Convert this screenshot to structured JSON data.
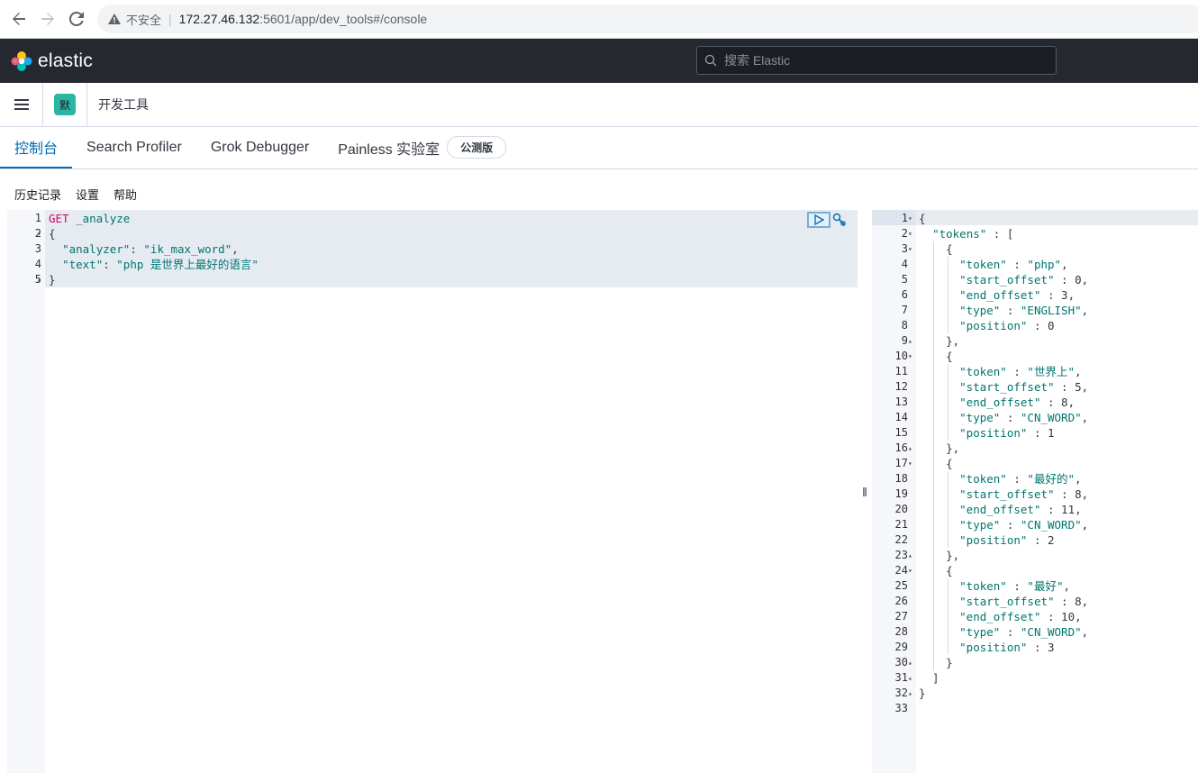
{
  "browser": {
    "security_label": "不安全",
    "url_host": "172.27.46.132",
    "url_path": ":5601/app/dev_tools#/console"
  },
  "header": {
    "logo_text": "elastic",
    "search_placeholder": "搜索 Elastic"
  },
  "subheader": {
    "space_initial": "默",
    "breadcrumb": "开发工具"
  },
  "tabs": [
    {
      "label": "控制台",
      "active": true
    },
    {
      "label": "Search Profiler",
      "active": false
    },
    {
      "label": "Grok Debugger",
      "active": false
    },
    {
      "label": "Painless 实验室",
      "active": false
    }
  ],
  "beta_badge": "公测版",
  "console_menu": [
    "历史记录",
    "设置",
    "帮助"
  ],
  "request": {
    "method": "GET",
    "endpoint": "_analyze",
    "lines": [
      {
        "no": "1",
        "fold": "",
        "segments": []
      },
      {
        "no": "2",
        "fold": "▾",
        "text": "{"
      },
      {
        "no": "3",
        "fold": "",
        "key": "\"analyzer\"",
        "value": "\"ik_max_word\"",
        "suffix": ","
      },
      {
        "no": "4",
        "fold": "",
        "key": "\"text\"",
        "value": "\"php 是世界上最好的语言\"",
        "suffix": ""
      },
      {
        "no": "5",
        "fold": "▴",
        "text": "}"
      }
    ]
  },
  "response": {
    "lines": [
      {
        "no": "1",
        "fold": "▾",
        "text": "{"
      },
      {
        "no": "2",
        "fold": "▾",
        "text": "  \"tokens\" : ["
      },
      {
        "no": "3",
        "fold": "▾",
        "text": "    {"
      },
      {
        "no": "4",
        "fold": "",
        "text": "      \"token\" : \"php\","
      },
      {
        "no": "5",
        "fold": "",
        "text": "      \"start_offset\" : 0,"
      },
      {
        "no": "6",
        "fold": "",
        "text": "      \"end_offset\" : 3,"
      },
      {
        "no": "7",
        "fold": "",
        "text": "      \"type\" : \"ENGLISH\","
      },
      {
        "no": "8",
        "fold": "",
        "text": "      \"position\" : 0"
      },
      {
        "no": "9",
        "fold": "▴",
        "text": "    },"
      },
      {
        "no": "10",
        "fold": "▾",
        "text": "    {"
      },
      {
        "no": "11",
        "fold": "",
        "text": "      \"token\" : \"世界上\","
      },
      {
        "no": "12",
        "fold": "",
        "text": "      \"start_offset\" : 5,"
      },
      {
        "no": "13",
        "fold": "",
        "text": "      \"end_offset\" : 8,"
      },
      {
        "no": "14",
        "fold": "",
        "text": "      \"type\" : \"CN_WORD\","
      },
      {
        "no": "15",
        "fold": "",
        "text": "      \"position\" : 1"
      },
      {
        "no": "16",
        "fold": "▴",
        "text": "    },"
      },
      {
        "no": "17",
        "fold": "▾",
        "text": "    {"
      },
      {
        "no": "18",
        "fold": "",
        "text": "      \"token\" : \"最好的\","
      },
      {
        "no": "19",
        "fold": "",
        "text": "      \"start_offset\" : 8,"
      },
      {
        "no": "20",
        "fold": "",
        "text": "      \"end_offset\" : 11,"
      },
      {
        "no": "21",
        "fold": "",
        "text": "      \"type\" : \"CN_WORD\","
      },
      {
        "no": "22",
        "fold": "",
        "text": "      \"position\" : 2"
      },
      {
        "no": "23",
        "fold": "▴",
        "text": "    },"
      },
      {
        "no": "24",
        "fold": "▾",
        "text": "    {"
      },
      {
        "no": "25",
        "fold": "",
        "text": "      \"token\" : \"最好\","
      },
      {
        "no": "26",
        "fold": "",
        "text": "      \"start_offset\" : 8,"
      },
      {
        "no": "27",
        "fold": "",
        "text": "      \"end_offset\" : 10,"
      },
      {
        "no": "28",
        "fold": "",
        "text": "      \"type\" : \"CN_WORD\","
      },
      {
        "no": "29",
        "fold": "",
        "text": "      \"position\" : 3"
      },
      {
        "no": "30",
        "fold": "▴",
        "text": "    }"
      },
      {
        "no": "31",
        "fold": "▴",
        "text": "  ]"
      },
      {
        "no": "32",
        "fold": "▴",
        "text": "}"
      },
      {
        "no": "33",
        "fold": "",
        "text": ""
      }
    ]
  },
  "colors": {
    "header_bg": "#25282f",
    "accent": "#006bb4",
    "method": "#c80a68",
    "string": "#00756f",
    "space_avatar": "#2bb5a4"
  }
}
